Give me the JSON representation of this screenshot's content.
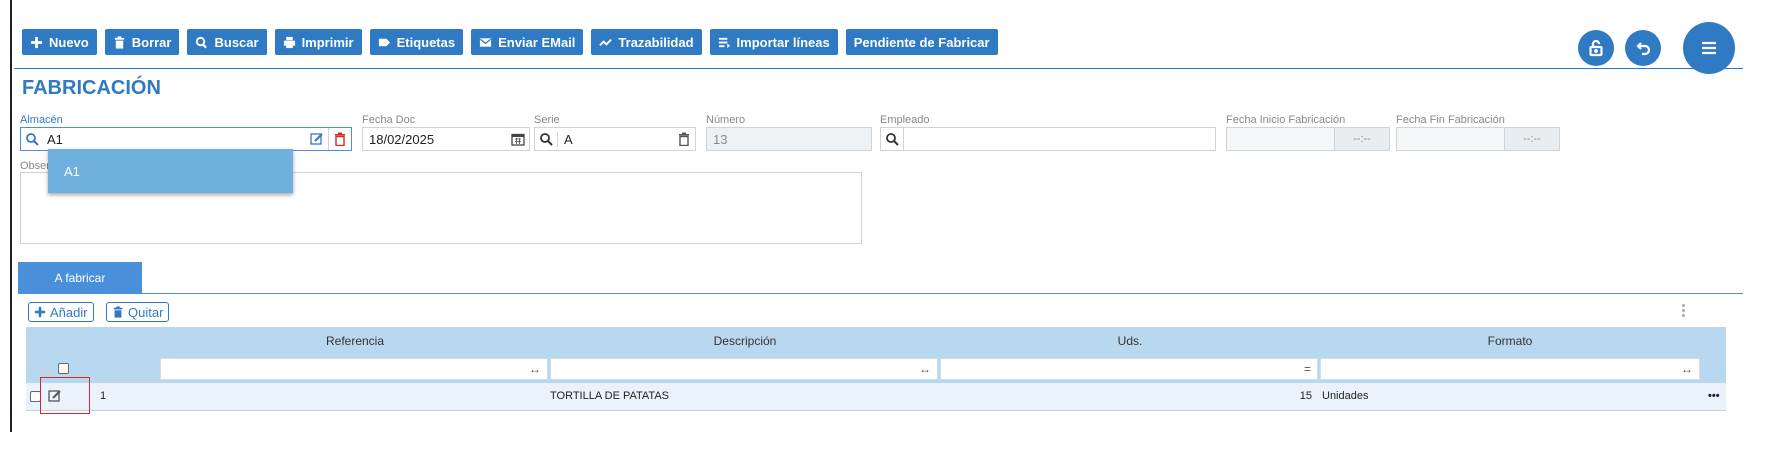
{
  "toolbar": {
    "buttons": [
      {
        "label": "Nuevo",
        "icon": "plus-icon"
      },
      {
        "label": "Borrar",
        "icon": "trash-icon"
      },
      {
        "label": "Buscar",
        "icon": "search-icon"
      },
      {
        "label": "Imprimir",
        "icon": "printer-icon"
      },
      {
        "label": "Etiquetas",
        "icon": "tag-icon"
      },
      {
        "label": "Enviar EMail",
        "icon": "mail-icon"
      },
      {
        "label": "Trazabilidad",
        "icon": "trend-icon"
      },
      {
        "label": "Importar líneas",
        "icon": "import-lines-icon"
      },
      {
        "label": "Pendiente de Fabricar",
        "icon": ""
      }
    ]
  },
  "page": {
    "title": "FABRICACIÓN"
  },
  "form": {
    "almacen": {
      "label": "Almacén",
      "value": "A1"
    },
    "fecha_doc": {
      "label": "Fecha Doc",
      "value": "18/02/2025"
    },
    "serie": {
      "label": "Serie",
      "value": "A"
    },
    "numero": {
      "label": "Número",
      "value": "13"
    },
    "empleado": {
      "label": "Empleado",
      "value": ""
    },
    "fecha_inicio": {
      "label": "Fecha Inicio Fabricación",
      "time": "--:--"
    },
    "fecha_fin": {
      "label": "Fecha Fin Fabricación",
      "time": "--:--"
    },
    "observaciones": {
      "label": "Obser"
    }
  },
  "dropdown": {
    "options": [
      "A1"
    ]
  },
  "tabs": [
    {
      "label": "A fabricar",
      "active": true
    }
  ],
  "grid": {
    "add_label": "Añadir",
    "remove_label": "Quitar",
    "columns": [
      "Referencia",
      "Descripción",
      "Uds.",
      "Formato"
    ],
    "filters": {
      "referencia": "↔",
      "descripcion": "↔",
      "uds": "=",
      "formato": "↔"
    },
    "rows": [
      {
        "referencia": "1",
        "descripcion": "TORTILLA DE PATATAS",
        "uds": "15",
        "formato": "Unidades",
        "more": "•••"
      }
    ]
  },
  "colors": {
    "accent": "#2f7ac2",
    "header_bg": "#b8d8f0",
    "highlight": "#d9262b"
  }
}
